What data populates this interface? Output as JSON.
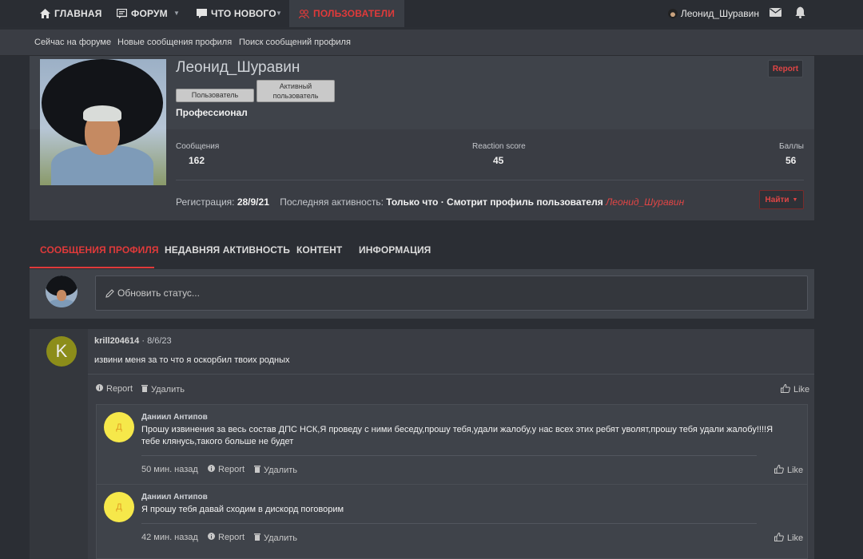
{
  "topnav": {
    "items": [
      {
        "label": "ГЛАВНАЯ"
      },
      {
        "label": "ФОРУМ"
      },
      {
        "label": "ЧТО НОВОГО"
      },
      {
        "label": "ПОЛЬЗОВАТЕЛИ"
      }
    ],
    "username": "Леонид_Шуравин"
  },
  "subnav": {
    "items": [
      "Сейчас на форуме",
      "Новые сообщения профиля",
      "Поиск сообщений профиля"
    ]
  },
  "profile": {
    "name": "Леонид_Шуравин",
    "badges": [
      "Пользователь",
      "Активный пользователь"
    ],
    "title": "Профессионал",
    "report": "Report",
    "stats": [
      {
        "label": "Сообщения",
        "value": "162"
      },
      {
        "label": "Reaction score",
        "value": "45"
      },
      {
        "label": "Баллы",
        "value": "56"
      }
    ],
    "reg_label": "Регистрация:",
    "reg_date": "28/9/21",
    "activity_label": "Последняя активность:",
    "activity_value": "Только что · Смотрит профиль пользователя",
    "activity_user": "Леонид_Шуравин",
    "find": "Найти"
  },
  "tabs": [
    "СООБЩЕНИЯ ПРОФИЛЯ",
    "НЕДАВНЯЯ АКТИВНОСТЬ",
    "КОНТЕНТ",
    "ИНФОРМАЦИЯ"
  ],
  "status": {
    "placeholder": "Обновить статус..."
  },
  "post": {
    "avatar_letter": "K",
    "author": "krill204614",
    "date": "· 8/6/23",
    "text": "извини меня за то что я оскорбил твоих родных",
    "actions": {
      "report": "Report",
      "delete": "Удалить",
      "like": "Like"
    },
    "comments": [
      {
        "avatar_letter": "Д",
        "author": "Даниил Антипов",
        "text": "Прошу извинения за весь состав ДПС НСК,Я проведу с ними беседу,прошу тебя,удали жалобу,у нас всех этих ребят уволят,прошу тебя удали жалобу!!!!Я тебе клянусь,такого больше не будет",
        "time": "50 мин. назад",
        "report": "Report",
        "delete": "Удалить",
        "like": "Like"
      },
      {
        "avatar_letter": "Д",
        "author": "Даниил Антипов",
        "text": "Я прошу тебя давай сходим в дискорд поговорим",
        "time": "42 мин. назад",
        "report": "Report",
        "delete": "Удалить",
        "like": "Like"
      }
    ]
  },
  "colors": {
    "accent": "#e03a3a",
    "background": "#2b2e34",
    "panel": "#3a3d44"
  }
}
